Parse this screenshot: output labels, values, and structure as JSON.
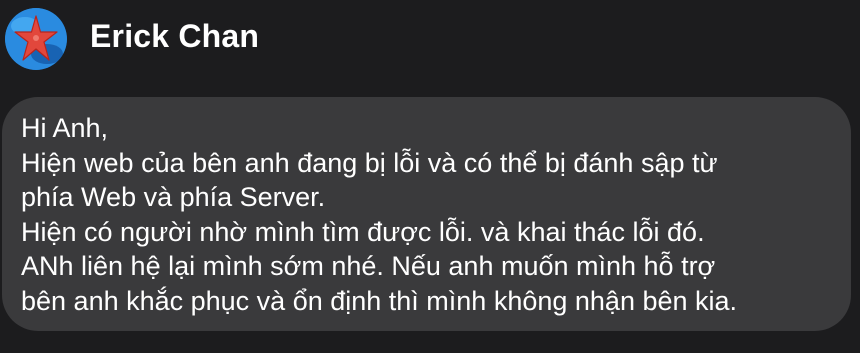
{
  "chat": {
    "sender_name": "Erick Chan",
    "avatar_icon": "starfish-avatar-icon"
  },
  "message": {
    "lines": [
      "Hi Anh,",
      "Hiện web của bên anh đang bị lỗi và có thể bị đánh sập từ",
      "phía Web và phía Server.",
      "Hiện có người nhờ mình tìm được lỗi. và khai thác lỗi đó.",
      "ANh liên hệ lại mình sớm nhé. Nếu anh muốn mình hỗ trợ",
      "bên anh khắc phục và ổn định thì mình không nhận bên kia."
    ]
  },
  "colors": {
    "background": "#1c1c1e",
    "bubble": "#3a3a3c",
    "text": "#ffffff"
  }
}
